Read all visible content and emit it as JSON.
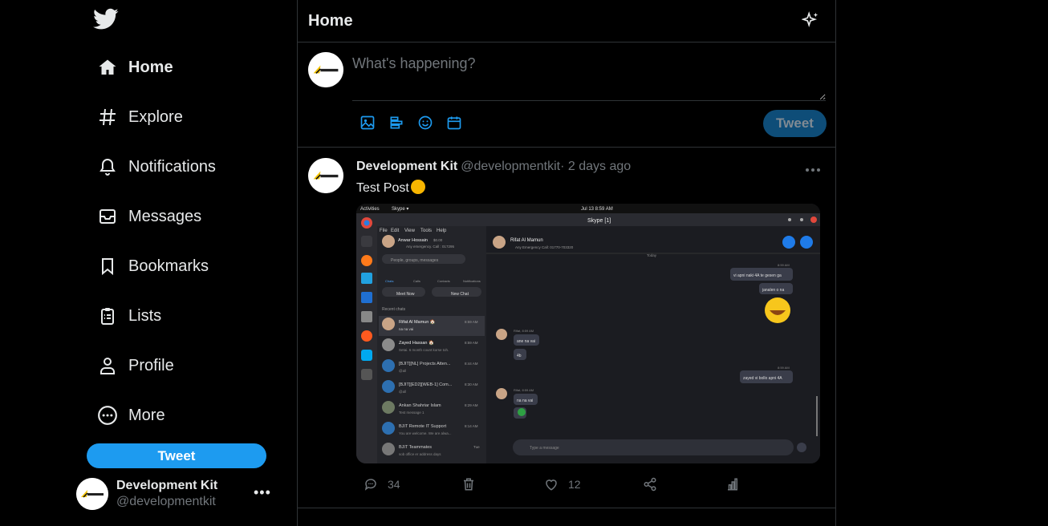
{
  "sidebar": {
    "logo_icon": "twitter-bird-icon",
    "items": [
      {
        "label": "Home",
        "icon": "home-icon",
        "active": true
      },
      {
        "label": "Explore",
        "icon": "hashtag-icon"
      },
      {
        "label": "Notifications",
        "icon": "bell-icon"
      },
      {
        "label": "Messages",
        "icon": "envelope-icon"
      },
      {
        "label": "Bookmarks",
        "icon": "bookmark-icon"
      },
      {
        "label": "Lists",
        "icon": "list-icon"
      },
      {
        "label": "Profile",
        "icon": "person-icon"
      },
      {
        "label": "More",
        "icon": "more-circle-icon"
      }
    ],
    "tweet_label": "Tweet",
    "account": {
      "name": "Development Kit",
      "handle": "@developmentkit"
    }
  },
  "header": {
    "title": "Home"
  },
  "composer": {
    "placeholder": "What's happening?",
    "tweet_label": "Tweet"
  },
  "post": {
    "author": "Development Kit",
    "handle": "@developmentkit",
    "time": "· 2 days ago",
    "text": "Test Post",
    "reply_count": "34",
    "like_count": "12"
  },
  "screenshot": {
    "topbar_left": "Activities",
    "topbar_app": "Skype ▾",
    "topbar_time": "Jul 13  8:59 AM",
    "window_title": "Skype [1]",
    "menu": [
      "File",
      "Edit",
      "View",
      "Tools",
      "Help"
    ],
    "me_name": "Anwar Hossain",
    "me_balance": "$0.00",
    "me_status": "Any emergency. Call : 017295",
    "search_placeholder": "People, groups, messages",
    "tabs": [
      "Chats",
      "Calls",
      "Contacts",
      "Notifications"
    ],
    "meet_now": "Meet Now",
    "new_chat": "New Chat",
    "recent_label": "Recent chats",
    "chats": [
      {
        "name": "Rifat Al Mamun 🏠",
        "preview": "na na vai",
        "time": "8:59 AM"
      },
      {
        "name": "Zayed Hassan 🏠",
        "preview": "Setai. 6 month count korse toh.",
        "time": "8:59 AM"
      },
      {
        "name": "[BJIT][NL] Projects Atten...",
        "preview": "@all",
        "time": "8:44 AM"
      },
      {
        "name": "[BJIT][ED2][WEB-1] Com...",
        "preview": "@all",
        "time": "8:30 AM"
      },
      {
        "name": "Ankan Shahriar Islam",
        "preview": "Test message 1",
        "time": "8:29 AM"
      },
      {
        "name": "BJIT Remote IT Support",
        "preview": "You are welcome. We are alwa...",
        "time": "8:14 AM"
      },
      {
        "name": "BJIT Teammates",
        "preview": "sob office er address days",
        "time": "Tue"
      }
    ],
    "contact_name": "Rifat Al Mamun",
    "contact_status": "Any Emergency Call: 01770-703320",
    "today": "Today",
    "msgs_out_1": [
      "vi apni naki 4A te gesen ga",
      "janalen o na"
    ],
    "msg_in_1": [
      "ane na vai",
      "4b"
    ],
    "msg_out_2": "zayed vi bollo apni 4A",
    "msg_in_2": "na na vai",
    "time_label": "8:59 AM",
    "sender_line": "Rifat, 8:59 AM",
    "type_placeholder": "Type a message"
  },
  "colors": {
    "accent": "#1d9bf0",
    "background": "#000000",
    "muted": "#71767b",
    "border": "#2f3336"
  }
}
